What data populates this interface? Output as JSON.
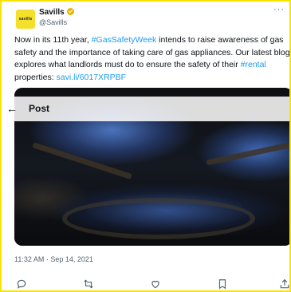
{
  "tweet": {
    "author_name": "Savills",
    "author_handle": "@Savills",
    "avatar_logo_text": "savills",
    "more_label": "···",
    "text_parts": {
      "p1": "Now in its 11th year, ",
      "hashtag1": "#GasSafetyWeek",
      "p2": " intends to raise awareness of gas safety and the importance of taking care of gas appliances. Our latest blog explores what landlords must do to ensure the safety of their ",
      "hashtag2": "#rental",
      "p3": " properties: ",
      "link": "savi.li/6017XRPBF"
    },
    "timestamp": "11:32 AM · Sep 14, 2021"
  },
  "overlay": {
    "back_glyph": "←",
    "title": "Post"
  },
  "actions": [
    {
      "name": "reply",
      "icon": "reply-icon"
    },
    {
      "name": "retweet",
      "icon": "retweet-icon"
    },
    {
      "name": "like",
      "icon": "heart-icon"
    },
    {
      "name": "bookmark",
      "icon": "bookmark-icon"
    },
    {
      "name": "share",
      "icon": "share-icon"
    }
  ],
  "colors": {
    "border": "#f7e400",
    "link": "#1d9bf0",
    "avatar_bg": "#f4df2a",
    "verified_badge": "#e8b500",
    "muted_text": "#536471"
  }
}
